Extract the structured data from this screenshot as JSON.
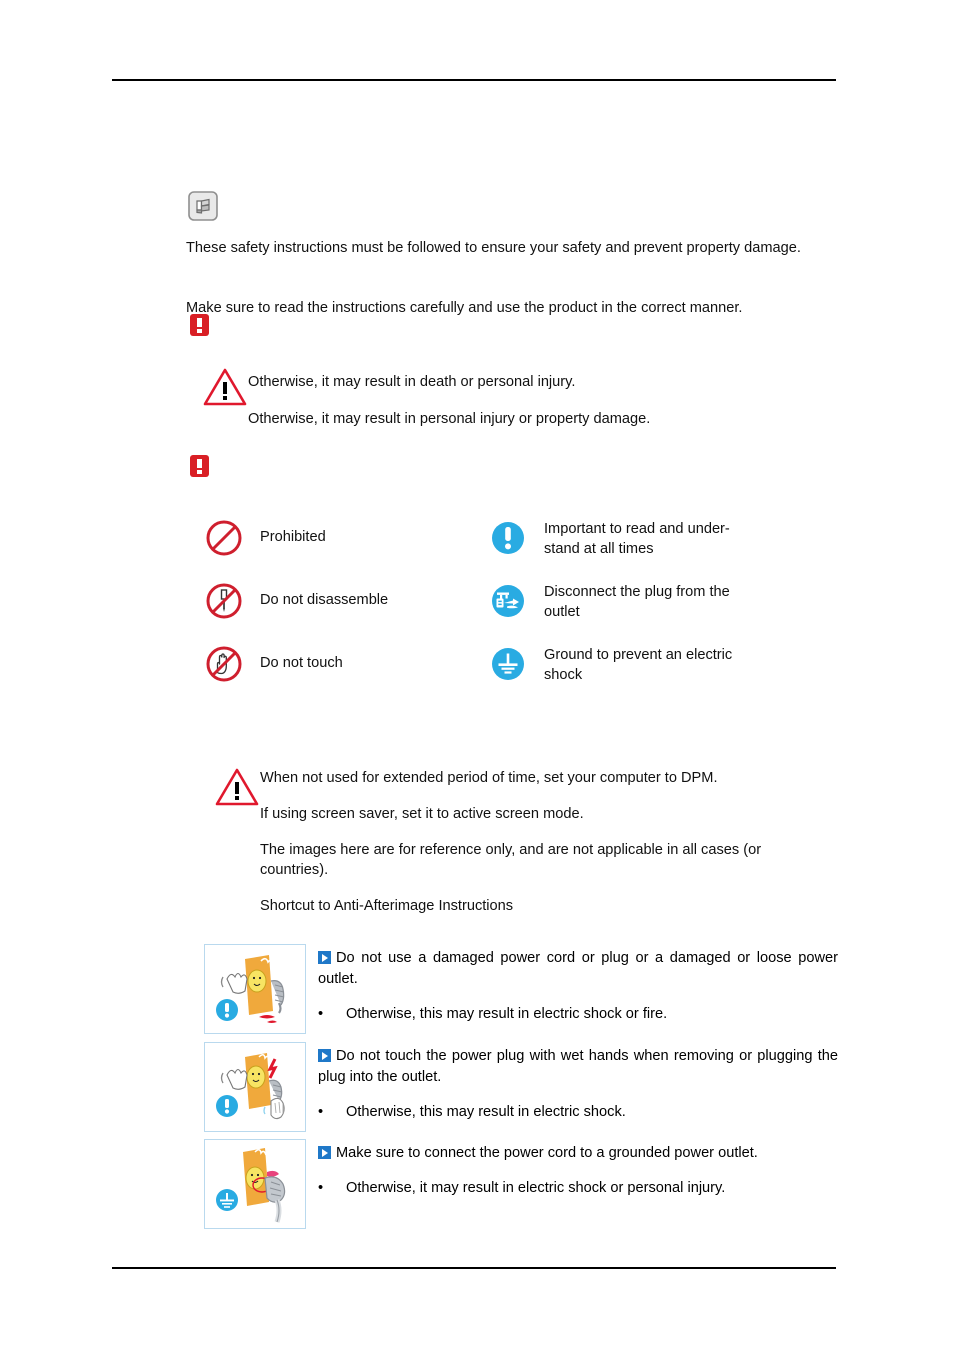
{
  "document": {
    "type": "safety-instructions-manual-page",
    "has_header_rule": true,
    "has_footer_rule": true
  },
  "colors": {
    "alert_red": "#d91f25",
    "prohibit_red": "#cf1f2e",
    "info_blue": "#29abe2",
    "arrow_blue": "#1f78c8",
    "thumb_border": "#b9d9ee",
    "rule_black": "#000000"
  },
  "note": {
    "icon": "note-pencil-icon",
    "paragraph_1": "These safety instructions must be followed to ensure your safety and prevent property damage.",
    "paragraph_2": "Make sure to read the instructions carefully and use the product in the correct manner."
  },
  "badges": {
    "exclamation_1": "exclamation-badge-icon",
    "exclamation_2": "exclamation-badge-icon"
  },
  "warning_block": {
    "icon": "warning-triangle-icon",
    "lines": [
      "Otherwise, it may result in death or personal injury.",
      "Otherwise, it may result in personal injury or property damage."
    ]
  },
  "legend": {
    "rows": [
      {
        "left": {
          "icon": "prohibited-icon",
          "label": "Prohibited"
        },
        "right": {
          "icon": "important-exclamation-icon",
          "label": "Important to read and under-\nstand at all times"
        }
      },
      {
        "left": {
          "icon": "do-not-disassemble-icon",
          "label": "Do not disassemble"
        },
        "right": {
          "icon": "disconnect-plug-icon",
          "label": "Disconnect the plug from the\noutlet"
        }
      },
      {
        "left": {
          "icon": "do-not-touch-icon",
          "label": "Do not touch"
        },
        "right": {
          "icon": "ground-icon",
          "label": "Ground to prevent an electric\nshock"
        }
      }
    ]
  },
  "dpm_block": {
    "icon": "warning-triangle-icon",
    "lines": [
      "When not used for extended period of time, set your computer to DPM.",
      "If using screen saver, set it to active screen mode.",
      "The images here are for reference only, and are not applicable in all cases (or countries).",
      "Shortcut to Anti-Afterimage Instructions"
    ]
  },
  "items": [
    {
      "thumbnail": "damaged-power-cord-illustration",
      "thumbnail_badge": "important-exclamation-icon",
      "marker": "blue-arrow-marker",
      "heading": "Do not use a damaged power cord or plug or a damaged or loose power outlet.",
      "bullet_char": "•",
      "bullet_text": "Otherwise, this may result in electric shock or fire."
    },
    {
      "thumbnail": "wet-hands-plug-illustration",
      "thumbnail_badge": "important-exclamation-icon",
      "marker": "blue-arrow-marker",
      "heading": "Do not touch the power plug with wet hands when removing or plugging the plug into the outlet.",
      "bullet_char": "•",
      "bullet_text": "Otherwise, this may result in electric shock."
    },
    {
      "thumbnail": "grounded-outlet-illustration",
      "thumbnail_badge": "ground-icon",
      "marker": "blue-arrow-marker",
      "heading": "Make sure to connect the power cord to a grounded power outlet.",
      "bullet_char": "•",
      "bullet_text": "Otherwise, it may result in electric shock or personal injury."
    }
  ]
}
